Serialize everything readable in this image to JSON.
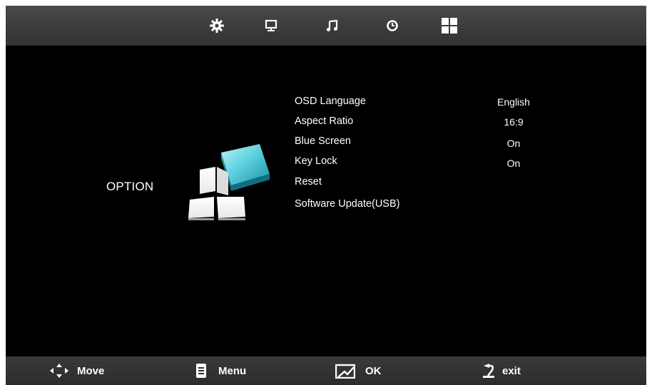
{
  "tabs": [
    {
      "icon": "gear-icon",
      "label": ""
    },
    {
      "icon": "monitor-icon",
      "label": ""
    },
    {
      "icon": "music-note-icon",
      "label": ""
    },
    {
      "icon": "clock-icon",
      "label": ""
    },
    {
      "icon": "grid-icon",
      "label": ""
    }
  ],
  "selected_tab": "grid-icon",
  "category": {
    "title": "OPTION",
    "icon": "option-tiles-icon",
    "accent_color": "#3fb8c8"
  },
  "menu": {
    "items": [
      {
        "label": "OSD Language",
        "value": "English"
      },
      {
        "label": "Aspect Ratio",
        "value": "16:9"
      },
      {
        "label": "Blue Screen",
        "value": "On"
      },
      {
        "label": "Key Lock",
        "value": "On"
      },
      {
        "label": "Reset",
        "value": ""
      },
      {
        "label": "Software Update(USB)",
        "value": ""
      }
    ]
  },
  "hints": {
    "move": {
      "label": "Move",
      "icon": "arrows-move-icon"
    },
    "menu": {
      "label": "Menu",
      "icon": "menu-list-icon"
    },
    "ok": {
      "label": "OK",
      "icon": "ok-check-icon"
    },
    "exit": {
      "label": "exit",
      "icon": "return-arrow-icon"
    }
  },
  "colors": {
    "background": "#000000",
    "bar": "#3c3c3c",
    "text": "#ffffff"
  }
}
